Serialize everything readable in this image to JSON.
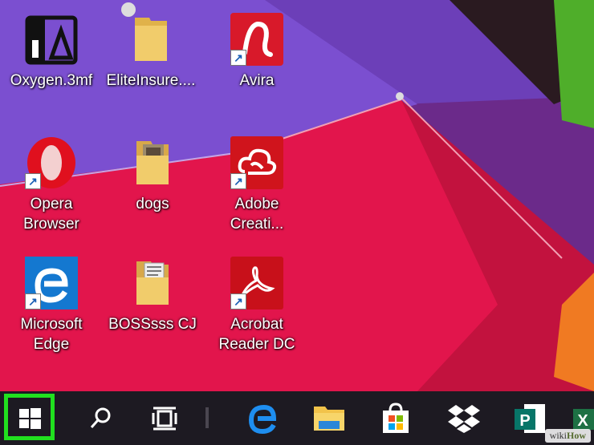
{
  "desktop": {
    "icons": [
      {
        "label": "Oxygen.3mf",
        "icon": "oxygen-3mf-file-icon"
      },
      {
        "label": "EliteInsure....",
        "icon": "folder-icon"
      },
      {
        "label": "Avira",
        "icon": "avira-icon",
        "shortcut": true
      },
      {
        "label": "Opera\nBrowser",
        "icon": "opera-icon",
        "shortcut": true
      },
      {
        "label": "dogs",
        "icon": "folder-icon"
      },
      {
        "label": "Adobe\nCreati...",
        "icon": "adobe-creative-cloud-icon",
        "shortcut": true
      },
      {
        "label": "Microsoft\nEdge",
        "icon": "edge-icon",
        "shortcut": true
      },
      {
        "label": "BOSSsss CJ",
        "icon": "folder-icon"
      },
      {
        "label": "Acrobat\nReader DC",
        "icon": "acrobat-reader-icon",
        "shortcut": true
      }
    ]
  },
  "taskbar": {
    "start": "start-windows-icon",
    "search": "search-icon",
    "task_view": "task-view-icon",
    "pinned": [
      "edge-icon",
      "file-explorer-icon",
      "microsoft-store-icon",
      "dropbox-icon",
      "publisher-icon",
      "excel-icon"
    ]
  },
  "colors": {
    "highlight": "#21e01f",
    "taskbar": "#1d1a22"
  },
  "watermark": {
    "prefix": "wiki",
    "suffix": "How"
  }
}
